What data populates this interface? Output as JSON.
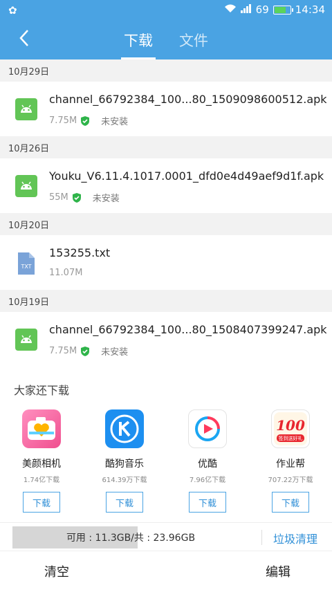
{
  "status_bar": {
    "signal_label": "69",
    "time": "14:34",
    "battery_level": 0.69
  },
  "header": {
    "tabs": [
      {
        "label": "下载",
        "active": true
      },
      {
        "label": "文件",
        "active": false
      }
    ]
  },
  "sections": [
    {
      "date": "10月29日",
      "file": {
        "name": "channel_66792384_100...80_1509098600512.apk",
        "size": "7.75M",
        "status": "未安装",
        "icon": "android-apk-icon"
      }
    },
    {
      "date": "10月26日",
      "file": {
        "name": "Youku_V6.11.4.1017.0001_dfd0e4d49aef9d1f.apk",
        "size": "55M",
        "status": "未安装",
        "icon": "android-apk-icon"
      }
    },
    {
      "date": "10月20日",
      "file": {
        "name": "153255.txt",
        "size": "11.07M",
        "status": "",
        "icon": "txt-file-icon",
        "icon_text": "TXT"
      }
    },
    {
      "date": "10月19日",
      "file": {
        "name": "channel_66792384_100...80_1508407399247.apk",
        "size": "7.75M",
        "status": "未安装",
        "icon": "android-apk-icon"
      }
    }
  ],
  "recommendations": {
    "title": "大家还下载",
    "button_label": "下载",
    "apps": [
      {
        "name": "美颜相机",
        "downloads": "1.74亿下载",
        "icon": "camera-heart-icon",
        "color": "#f56aa0"
      },
      {
        "name": "酷狗音乐",
        "downloads": "614.39万下载",
        "icon": "kugou-k-icon",
        "color": "#1d8ff0"
      },
      {
        "name": "优酷",
        "downloads": "7.96亿下载",
        "icon": "youku-play-icon",
        "color": "#ffffff"
      },
      {
        "name": "作业帮",
        "downloads": "707.22万下载",
        "icon": "zuoyebang-100-icon",
        "color": "#ffffff",
        "icon_text": "100",
        "icon_subtext": "签到送好礼"
      }
    ]
  },
  "storage": {
    "label": "可用 : 11.3GB/共 : 23.96GB",
    "used_fraction": 0.53,
    "cleanup_label": "垃圾清理"
  },
  "bottom": {
    "clear_label": "清空",
    "edit_label": "编辑"
  },
  "colors": {
    "accent": "#4aa3e3",
    "link": "#2f8fd7",
    "apk_green": "#62c556",
    "verified_green": "#2fb44a",
    "txt_blue": "#7aa3d8"
  }
}
